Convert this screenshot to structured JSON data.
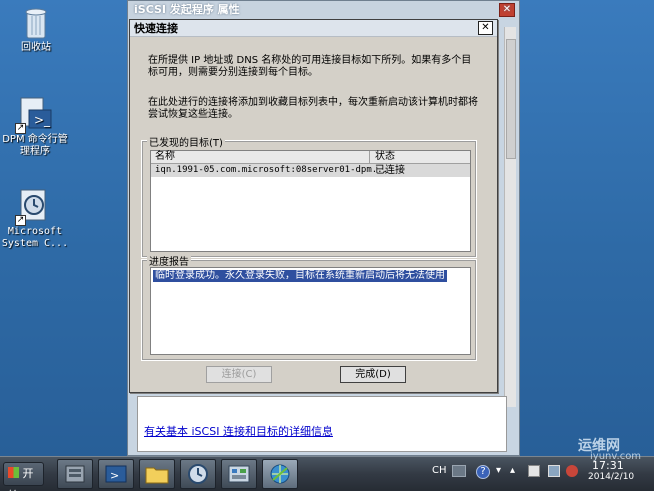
{
  "desktop": {
    "icons": [
      {
        "label_lines": [
          "回收站"
        ],
        "icon": "recycle-bin-icon"
      },
      {
        "label_lines": [
          "DPM 命令行管",
          "理程序"
        ],
        "icon": "dpm-shell-icon"
      },
      {
        "label_lines": [
          "Microsoft",
          "System C..."
        ],
        "icon": "system-center-icon"
      }
    ]
  },
  "outer_window": {
    "title": "iSCSI 发起程序 属性",
    "close_symbol": "✕",
    "link_text": "有关基本 iSCSI 连接和目标的详细信息"
  },
  "quick_connect": {
    "title": "快速连接",
    "close_symbol": "✕",
    "intro_line1": "在所提供 IP 地址或 DNS 名称处的可用连接目标如下所列。如果有多个目",
    "intro_line2": "标可用，则需要分别连接到每个目标。",
    "persist_line1": "在此处进行的连接将添加到收藏目标列表中，每次重新启动该计算机时都将",
    "persist_line2": "尝试恢复这些连接。",
    "discovered_label": "已发现的目标(T)",
    "columns": {
      "name": "名称",
      "status": "状态"
    },
    "targets": [
      {
        "name": "iqn.1991-05.com.microsoft:08server01-dpm...",
        "status": "已连接"
      }
    ],
    "progress_label": "进度报告",
    "progress_text": "临时登录成功。永久登录失败，目标在系统重新启动后将无法使用",
    "connect_button": "连接(C)",
    "done_button": "完成(D)"
  },
  "taskbar": {
    "start_label": "开始",
    "language": "CH",
    "clock": "17:31",
    "date": "2014/2/10",
    "watermark_line1": "运维网",
    "watermark_line2": "iyunv.com",
    "colors": {
      "taskbar": "#2b323b",
      "selection": "#2f4f9f",
      "close_button": "#c04030"
    }
  }
}
